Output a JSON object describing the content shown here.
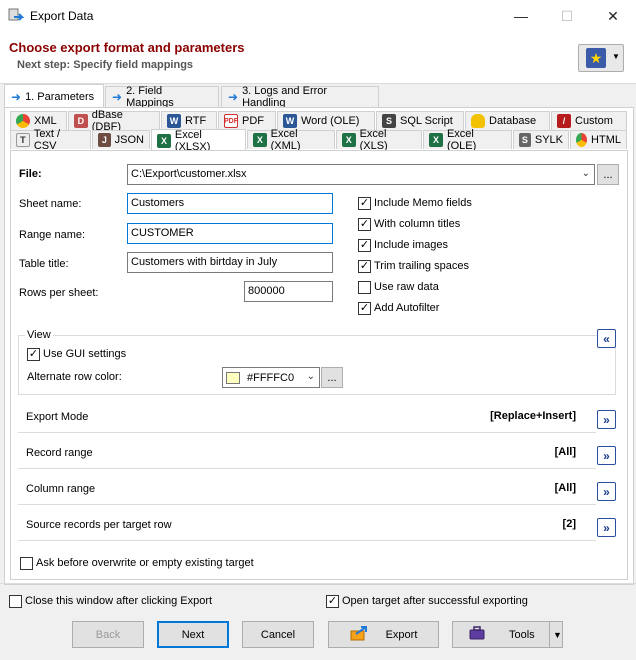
{
  "window": {
    "title": "Export Data"
  },
  "header": {
    "title": "Choose export format and parameters",
    "subtitle": "Next step: Specify field mappings"
  },
  "main_tabs": [
    {
      "label": "1. Parameters",
      "active": true
    },
    {
      "label": "2. Field Mappings",
      "active": false
    },
    {
      "label": "3. Logs and Error Handling",
      "active": false
    }
  ],
  "format_tabs_row1": [
    {
      "label": "XML",
      "icon": "chrome-icon"
    },
    {
      "label": "dBase (DBF)",
      "icon": "dbf-icon"
    },
    {
      "label": "RTF",
      "icon": "word-icon"
    },
    {
      "label": "PDF",
      "icon": "pdf-icon"
    },
    {
      "label": "Word (OLE)",
      "icon": "word-icon"
    },
    {
      "label": "SQL Script",
      "icon": "sql-icon"
    },
    {
      "label": "Database",
      "icon": "database-icon"
    },
    {
      "label": "Custom",
      "icon": "custom-icon"
    }
  ],
  "format_tabs_row2": [
    {
      "label": "Text / CSV",
      "icon": "text-icon"
    },
    {
      "label": "JSON",
      "icon": "json-icon"
    },
    {
      "label": "Excel (XLSX)",
      "icon": "excel-icon",
      "active": true
    },
    {
      "label": "Excel (XML)",
      "icon": "excel-icon"
    },
    {
      "label": "Excel (XLS)",
      "icon": "excel-icon"
    },
    {
      "label": "Excel (OLE)",
      "icon": "excel-icon"
    },
    {
      "label": "SYLK",
      "icon": "sylk-icon"
    },
    {
      "label": "HTML",
      "icon": "chrome-icon"
    }
  ],
  "form": {
    "file_label": "File:",
    "file_value": "C:\\Export\\customer.xlsx",
    "sheet_label": "Sheet name:",
    "sheet_value": "Customers",
    "range_label": "Range name:",
    "range_value": "CUSTOMER",
    "table_label": "Table title:",
    "table_value": "Customers with birtday in July",
    "rows_label": "Rows per sheet:",
    "rows_value": "800000",
    "dots": "..."
  },
  "options": [
    {
      "label": "Include Memo fields",
      "checked": true
    },
    {
      "label": "With column titles",
      "checked": true
    },
    {
      "label": "Include images",
      "checked": true
    },
    {
      "label": "Trim trailing spaces",
      "checked": true
    },
    {
      "label": "Use raw data",
      "checked": false
    },
    {
      "label": "Add Autofilter",
      "checked": true
    }
  ],
  "view": {
    "title": "View",
    "use_gui_label": "Use GUI settings",
    "use_gui_checked": true,
    "alt_row_label": "Alternate row color:",
    "alt_row_value": "#FFFFC0",
    "collapse_glyph": "«"
  },
  "sections": [
    {
      "label": "Export Mode",
      "value": "[Replace+Insert]"
    },
    {
      "label": "Record range",
      "value": "[All]"
    },
    {
      "label": "Column range",
      "value": "[All]"
    },
    {
      "label": "Source records per target row",
      "value": "[2]"
    }
  ],
  "expand_glyph": "»",
  "ask_overwrite": {
    "label": "Ask before overwrite or empty existing target",
    "checked": false
  },
  "footer": {
    "close_after_label": "Close this window after clicking Export",
    "close_after_checked": false,
    "open_target_label": "Open target after successful exporting",
    "open_target_checked": true
  },
  "buttons": {
    "back": "Back",
    "next": "Next",
    "cancel": "Cancel",
    "export": "Export",
    "tools": "Tools"
  },
  "colors": {
    "header_title": "#8b0000",
    "accent": "#0078d7",
    "swatch": "#FFFFC0"
  }
}
